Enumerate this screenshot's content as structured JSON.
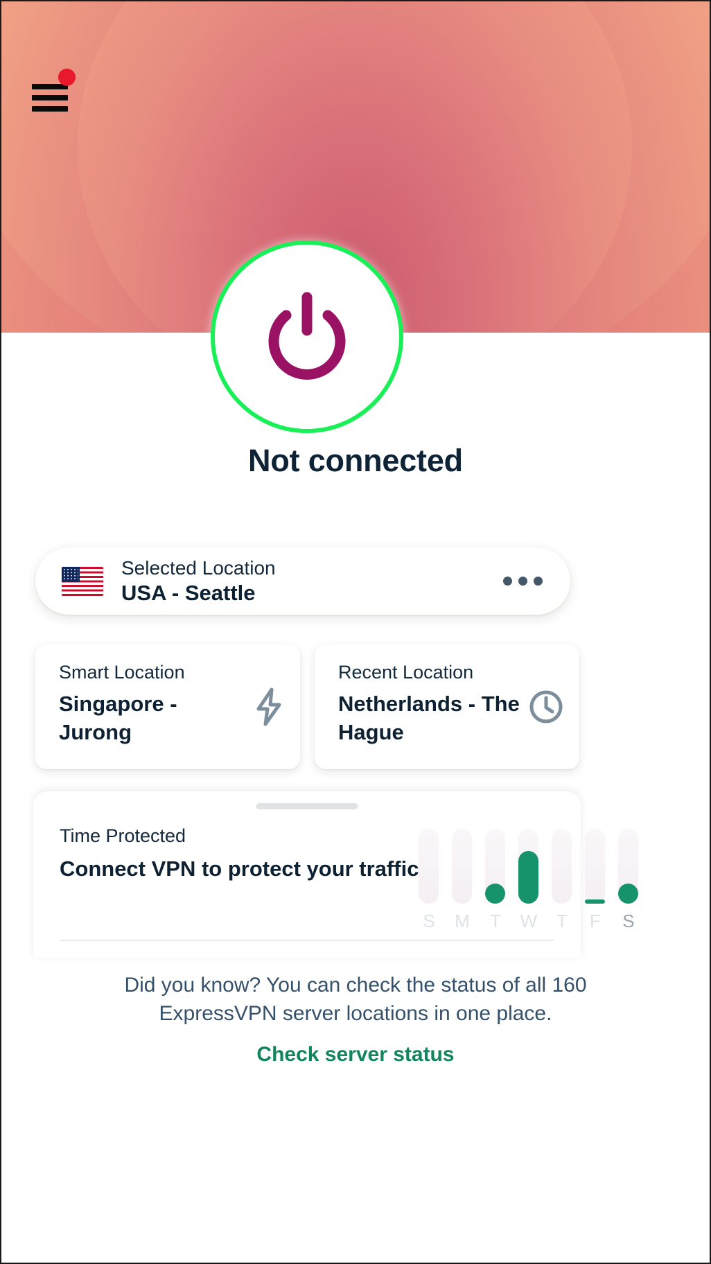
{
  "header": {
    "menu_icon": "hamburger-menu-icon",
    "notification_badge": "",
    "badge_color": "#e8192c"
  },
  "connection": {
    "power_icon": "power-icon",
    "status": "Not connected",
    "ring_color": "#19f057",
    "glyph_color": "#9a1263"
  },
  "selected_location": {
    "flag": "us-flag-icon",
    "label": "Selected Location",
    "value": "USA - Seattle",
    "menu_icon": "more-options-icon"
  },
  "locations": [
    {
      "label": "Smart Location",
      "value": "Singapore - Jurong",
      "icon": "lightning-bolt-icon"
    },
    {
      "label": "Recent Location",
      "value": "Netherlands - The Hague",
      "icon": "clock-icon"
    }
  ],
  "time_protected": {
    "label": "Time Protected",
    "value": "Connect VPN to protect your traffic",
    "grabber": "drag-handle"
  },
  "chart_data": {
    "type": "bar",
    "title": "Time Protected",
    "categories": [
      "S",
      "M",
      "T",
      "W",
      "T",
      "F",
      "S"
    ],
    "values": [
      0,
      0,
      22,
      70,
      0,
      3,
      18
    ],
    "series": [
      {
        "name": "Time Protected",
        "values": [
          0,
          0,
          22,
          70,
          0,
          3,
          18
        ]
      }
    ],
    "xlabel": "",
    "ylabel": "",
    "ylim": [
      0,
      100
    ],
    "grid": false,
    "legend": "none",
    "bar_color": "#17936c",
    "track_color": "#f2eaf0",
    "today_index": 6
  },
  "footer": {
    "tip": "Did you know? You can check the status of all 160 ExpressVPN server locations in one place.",
    "link": "Check server status",
    "link_color": "#13855e"
  }
}
